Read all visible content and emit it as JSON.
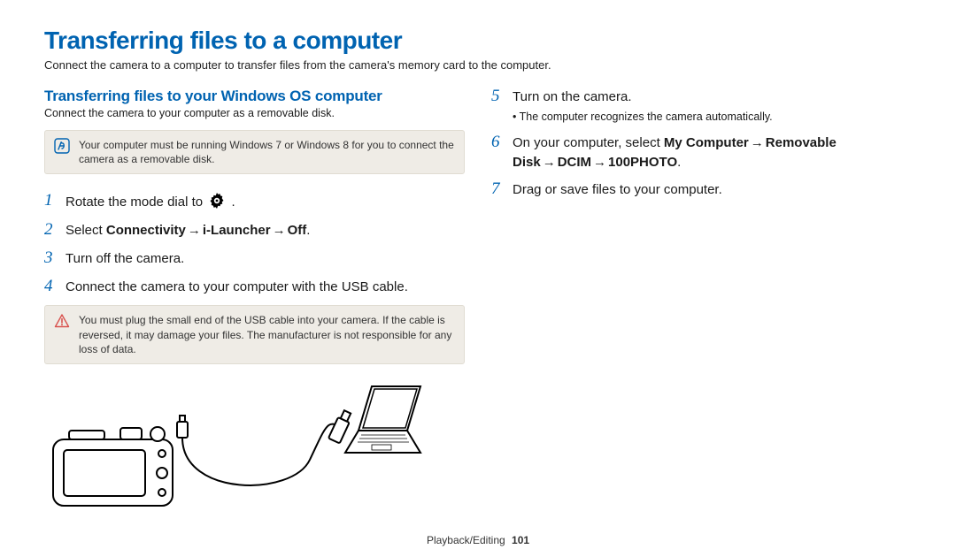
{
  "title": "Transferring files to a computer",
  "intro": "Connect the camera to a computer to transfer files from the camera's memory card to the computer.",
  "subhead": "Transferring files to your Windows OS computer",
  "sub_intro": "Connect the camera to your computer as a removable disk.",
  "info_note": "Your computer must be running Windows 7 or Windows 8 for you to connect the camera as a removable disk.",
  "warning_note": "You must plug the small end of the USB cable into your camera. If the cable is reversed, it may damage your files. The manufacturer is not responsible for any loss of data.",
  "steps_left": {
    "s1_before": "Rotate the mode dial to",
    "s1_after": ".",
    "s2_a": "Select ",
    "s2_b": "Connectivity",
    "s2_c": "i-Launcher",
    "s2_d": "Off",
    "s2_e": ".",
    "s3": "Turn off the camera.",
    "s4": "Connect the camera to your computer with the USB cable."
  },
  "steps_right": {
    "s5": "Turn on the camera.",
    "s5_sub": "The computer recognizes the camera automatically.",
    "s6_a": "On your computer, select ",
    "s6_b": "My Computer",
    "s6_c": "Removable Disk",
    "s6_d": "DCIM",
    "s6_e": "100PHOTO",
    "s6_f": ".",
    "s7": "Drag or save files to your computer."
  },
  "arrow": "→",
  "footer": {
    "section": "Playback/Editing",
    "page": "101"
  }
}
